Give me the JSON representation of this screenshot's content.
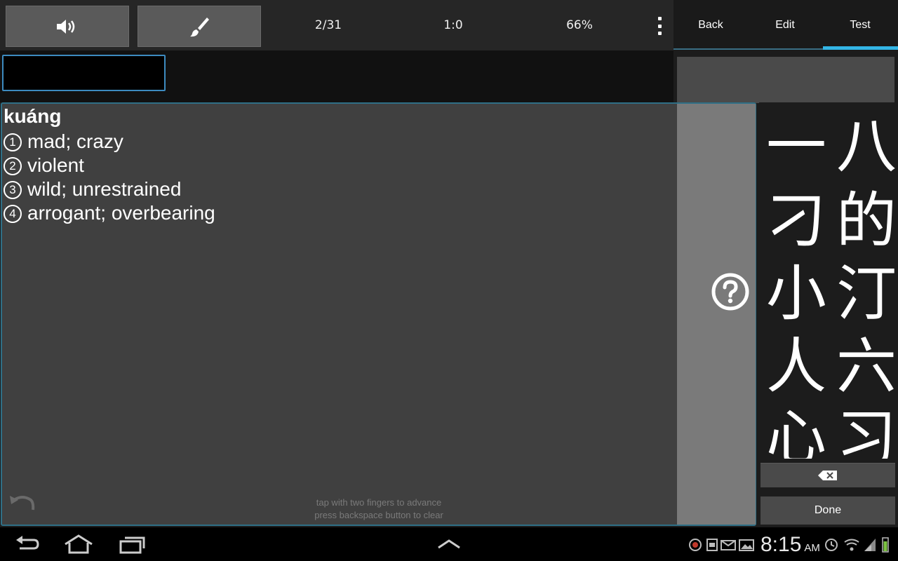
{
  "toolbar": {
    "speaker_icon": "speaker-icon",
    "brush_icon": "brush-icon",
    "progress": "2/31",
    "score": "1:0",
    "percent": "66%"
  },
  "tabs": [
    {
      "label": "Back"
    },
    {
      "label": "Edit"
    },
    {
      "label": "Test",
      "active": true
    }
  ],
  "answer_input": {
    "value": ""
  },
  "card": {
    "pinyin": "kuáng",
    "definitions": [
      {
        "num": "1",
        "text": "mad; crazy"
      },
      {
        "num": "2",
        "text": "violent"
      },
      {
        "num": "3",
        "text": "wild; unrestrained"
      },
      {
        "num": "4",
        "text": "arrogant; overbearing"
      }
    ],
    "hint_line1": "tap with two fingers to advance",
    "hint_line2": "press backspace button to clear"
  },
  "candidates": [
    [
      "一",
      "八"
    ],
    [
      "刁",
      "的"
    ],
    [
      "小",
      "汀"
    ],
    [
      "人",
      "六"
    ],
    [
      "心",
      "习"
    ]
  ],
  "keypad": {
    "done_label": "Done"
  },
  "status": {
    "time": "8:15",
    "ampm": "AM"
  },
  "colors": {
    "accent": "#33b5e5",
    "panel": "#404040",
    "border": "#2f6f86"
  }
}
